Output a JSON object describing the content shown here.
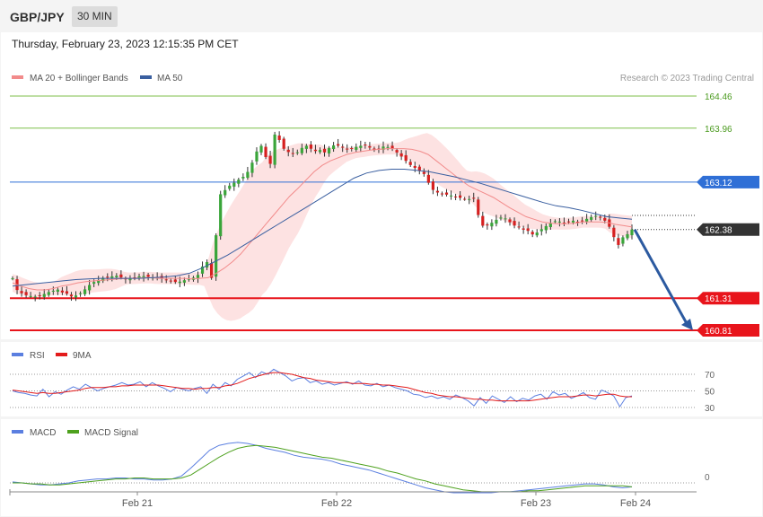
{
  "header": {
    "symbol": "GBP/JPY",
    "timeframe": "30 MIN",
    "datetime": "Thursday, February 23, 2023 12:15:35 PM CET"
  },
  "colors": {
    "ma20": "#f28b8b",
    "band_fill": "#fde2e2",
    "ma50": "#3a5fa0",
    "green_level": "#7cbf4a",
    "blue_level": "#2f6fd6",
    "red_level": "#e8141b",
    "current_label": "#333333",
    "arrow": "#2c5aa0",
    "rsi": "#5b7fe0",
    "rsi_ma": "#e31b1b",
    "macd": "#5b7fe0",
    "macd_signal": "#4ea11e",
    "candle_up": "#3aa53a",
    "candle_down": "#d62020"
  },
  "chart_data": [
    {
      "type": "candlestick",
      "legend": [
        "MA 20 + Bollinger Bands",
        "MA 50"
      ],
      "legend_placement": "top-left",
      "credit": "Research © 2023 Trading Central",
      "ylim": [
        160.75,
        164.6
      ],
      "x_labels": [
        "Feb 21",
        "Feb 22",
        "Feb 23",
        "Feb 24"
      ],
      "levels": [
        {
          "value": 164.46,
          "label": "164.46",
          "color": "green"
        },
        {
          "value": 163.96,
          "label": "163.96",
          "color": "green"
        },
        {
          "value": 163.12,
          "label": "163.12",
          "color": "blue"
        },
        {
          "value": 162.38,
          "label": "162.38",
          "color": "current"
        },
        {
          "value": 161.31,
          "label": "161.31",
          "color": "red"
        },
        {
          "value": 160.81,
          "label": "160.81",
          "color": "red"
        }
      ],
      "close_path": [
        161.62,
        161.42,
        161.38,
        161.35,
        161.34,
        161.33,
        161.36,
        161.4,
        161.42,
        161.45,
        161.4,
        161.38,
        161.33,
        161.36,
        161.4,
        161.48,
        161.55,
        161.58,
        161.62,
        161.64,
        161.65,
        161.66,
        161.63,
        161.6,
        161.62,
        161.64,
        161.66,
        161.65,
        161.63,
        161.64,
        161.62,
        161.6,
        161.58,
        161.56,
        161.57,
        161.6,
        161.62,
        161.64,
        161.72,
        161.98,
        161.52,
        162.25,
        162.95,
        163.0,
        163.08,
        163.12,
        163.18,
        163.22,
        163.35,
        163.55,
        163.72,
        163.52,
        163.4,
        163.9,
        163.75,
        163.6,
        163.58,
        163.55,
        163.62,
        163.7,
        163.65,
        163.6,
        163.62,
        163.58,
        163.66,
        163.7,
        163.68,
        163.64,
        163.62,
        163.66,
        163.68,
        163.7,
        163.66,
        163.62,
        163.64,
        163.68,
        163.66,
        163.62,
        163.55,
        163.48,
        163.4,
        163.35,
        163.3,
        163.25,
        163.1,
        162.98,
        162.95,
        162.93,
        162.92,
        162.9,
        162.88,
        162.86,
        162.85,
        162.88,
        162.6,
        162.42,
        162.45,
        162.5,
        162.55,
        162.58,
        162.52,
        162.45,
        162.42,
        162.38,
        162.36,
        162.3,
        162.34,
        162.4,
        162.45,
        162.5,
        162.52,
        162.48,
        162.5,
        162.52,
        162.5,
        162.52,
        162.55,
        162.58,
        162.6,
        162.56,
        162.48,
        162.35,
        162.1,
        162.25,
        162.3,
        162.38
      ],
      "ma20_path": [
        161.55,
        161.5,
        161.46,
        161.44,
        161.44,
        161.46,
        161.5,
        161.52,
        161.55,
        161.57,
        161.58,
        161.59,
        161.6,
        161.61,
        161.62,
        161.62,
        161.63,
        161.63,
        161.62,
        161.62,
        161.62,
        161.62,
        161.61,
        161.62,
        161.63,
        161.7,
        161.78,
        161.88,
        162.0,
        162.15,
        162.3,
        162.45,
        162.6,
        162.75,
        162.9,
        163.02,
        163.15,
        163.28,
        163.38,
        163.45,
        163.5,
        163.55,
        163.58,
        163.6,
        163.62,
        163.63,
        163.64,
        163.64,
        163.64,
        163.63,
        163.6,
        163.55,
        163.45,
        163.35,
        163.25,
        163.15,
        163.06,
        163.0,
        162.94,
        162.88,
        162.8,
        162.72,
        162.65,
        162.58,
        162.54,
        162.5,
        162.48,
        162.47,
        162.47,
        162.48,
        162.5,
        162.5,
        162.5,
        162.49,
        162.46,
        162.44,
        162.42
      ],
      "ma50_path": [
        161.5,
        161.52,
        161.54,
        161.56,
        161.58,
        161.6,
        161.61,
        161.62,
        161.62,
        161.62,
        161.62,
        161.63,
        161.64,
        161.66,
        161.7,
        161.78,
        161.88,
        161.98,
        162.1,
        162.22,
        162.34,
        162.46,
        162.58,
        162.7,
        162.82,
        162.94,
        163.06,
        163.18,
        163.26,
        163.3,
        163.32,
        163.32,
        163.3,
        163.28,
        163.24,
        163.2,
        163.15,
        163.1,
        163.04,
        162.98,
        162.92,
        162.86,
        162.8,
        162.75,
        162.72,
        162.68,
        162.63,
        162.58,
        162.56,
        162.54
      ],
      "arrow": {
        "from": 162.38,
        "to": 160.81
      }
    },
    {
      "type": "line",
      "legend": [
        "RSI",
        "9MA"
      ],
      "y_ticks": [
        70,
        50,
        30
      ],
      "ylim": [
        25,
        80
      ],
      "rsi": [
        50,
        48,
        47,
        45,
        44,
        52,
        43,
        49,
        46,
        51,
        55,
        52,
        58,
        54,
        50,
        53,
        55,
        57,
        60,
        57,
        58,
        61,
        55,
        60,
        56,
        53,
        49,
        54,
        52,
        50,
        53,
        55,
        47,
        58,
        52,
        60,
        56,
        64,
        68,
        72,
        66,
        73,
        70,
        76,
        72,
        68,
        62,
        65,
        66,
        60,
        62,
        58,
        60,
        57,
        59,
        61,
        58,
        62,
        57,
        56,
        59,
        55,
        57,
        54,
        52,
        50,
        46,
        45,
        42,
        44,
        41,
        43,
        40,
        45,
        42,
        38,
        32,
        42,
        35,
        44,
        40,
        36,
        43,
        37,
        41,
        39,
        44,
        46,
        40,
        49,
        45,
        47,
        41,
        44,
        48,
        42,
        40,
        51,
        48,
        44,
        31,
        42,
        44
      ],
      "rsi_ma": [
        51,
        50,
        49,
        48,
        47,
        48,
        47,
        47,
        48,
        49,
        50,
        51,
        53,
        54,
        54,
        54,
        55,
        55,
        56,
        56,
        57,
        57,
        57,
        57,
        57,
        56,
        55,
        54,
        53,
        53,
        52,
        53,
        53,
        54,
        54,
        56,
        57,
        59,
        62,
        65,
        67,
        69,
        71,
        72,
        72,
        71,
        70,
        68,
        66,
        65,
        63,
        62,
        61,
        60,
        60,
        60,
        59,
        59,
        59,
        58,
        58,
        57,
        57,
        56,
        55,
        54,
        52,
        50,
        48,
        47,
        45,
        44,
        43,
        43,
        42,
        41,
        40,
        40,
        39,
        39,
        38,
        38,
        38,
        38,
        38,
        38,
        39,
        40,
        41,
        42,
        43,
        43,
        43,
        44,
        45,
        45,
        44,
        45,
        46,
        46,
        44,
        43,
        43
      ]
    },
    {
      "type": "line",
      "legend": [
        "MACD",
        "MACD Signal"
      ],
      "y_ticks": [
        0
      ],
      "ylim": [
        -0.2,
        0.6
      ],
      "macd": [
        0.01,
        0.0,
        -0.01,
        -0.02,
        -0.02,
        -0.01,
        0.0,
        0.02,
        0.03,
        0.04,
        0.04,
        0.05,
        0.05,
        0.04,
        0.04,
        0.03,
        0.03,
        0.04,
        0.07,
        0.15,
        0.24,
        0.33,
        0.38,
        0.4,
        0.41,
        0.4,
        0.38,
        0.35,
        0.33,
        0.31,
        0.28,
        0.26,
        0.25,
        0.24,
        0.22,
        0.19,
        0.17,
        0.15,
        0.13,
        0.1,
        0.07,
        0.04,
        0.01,
        -0.02,
        -0.05,
        -0.07,
        -0.09,
        -0.1,
        -0.1,
        -0.1,
        -0.1,
        -0.1,
        -0.09,
        -0.09,
        -0.08,
        -0.07,
        -0.06,
        -0.05,
        -0.04,
        -0.03,
        -0.02,
        -0.01,
        -0.01,
        -0.02,
        -0.04,
        -0.05,
        -0.04
      ],
      "macd_signal": [
        0.0,
        0.0,
        -0.01,
        -0.01,
        -0.02,
        -0.02,
        -0.01,
        0.0,
        0.01,
        0.02,
        0.03,
        0.04,
        0.04,
        0.05,
        0.05,
        0.04,
        0.04,
        0.04,
        0.05,
        0.08,
        0.14,
        0.2,
        0.26,
        0.31,
        0.35,
        0.37,
        0.38,
        0.37,
        0.36,
        0.34,
        0.32,
        0.3,
        0.28,
        0.26,
        0.25,
        0.23,
        0.21,
        0.19,
        0.17,
        0.15,
        0.12,
        0.1,
        0.07,
        0.04,
        0.02,
        -0.01,
        -0.03,
        -0.05,
        -0.07,
        -0.08,
        -0.09,
        -0.09,
        -0.09,
        -0.09,
        -0.09,
        -0.08,
        -0.08,
        -0.07,
        -0.06,
        -0.05,
        -0.04,
        -0.03,
        -0.03,
        -0.03,
        -0.03,
        -0.03,
        -0.04
      ]
    }
  ]
}
